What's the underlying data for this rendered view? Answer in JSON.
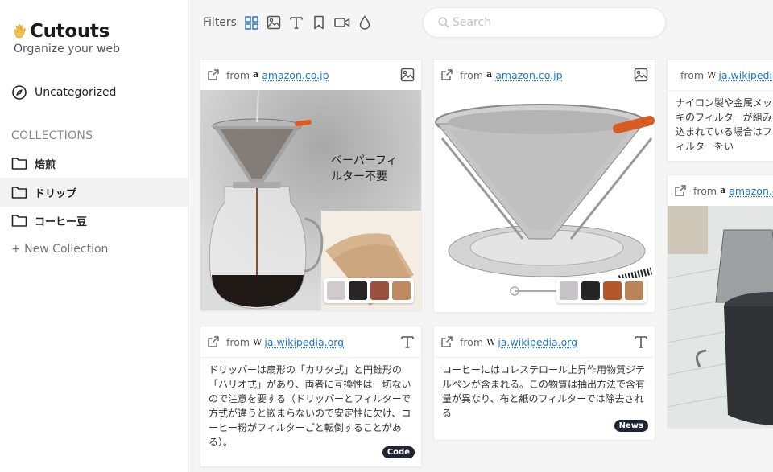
{
  "app": {
    "name": "Cutouts",
    "tagline": "Organize your web"
  },
  "sidebar": {
    "uncategorized": "Uncategorized",
    "collections_label": "COLLECTIONS",
    "collections": [
      "焙煎",
      "ドリップ",
      "コーヒー豆"
    ],
    "new_collection": "+ New Collection"
  },
  "toolbar": {
    "filters_label": "Filters",
    "filters": [
      "all-grid-icon",
      "image-icon",
      "text-icon",
      "bookmark-icon",
      "video-icon",
      "color-drop-icon"
    ],
    "search_placeholder": "Search",
    "accent": "#3b7bd8"
  },
  "cards": [
    {
      "from": "from",
      "source": "amazon.co.jp",
      "type": "image",
      "image_text": "ペーパーフィルター不要",
      "palette": [
        "#cfcbcc",
        "#282526",
        "#9b4f3d",
        "#c08a60"
      ]
    },
    {
      "from": "from",
      "source": "ja.wikipedia.org",
      "type": "text",
      "text": "ドリッパーは扇形の「カリタ式」と円錐形の「ハリオ式」があり、両者に互換性は一切ないので注意を要する（ドリッパーとフィルターで方式が違うと嵌まらないので安定性に欠け、コーヒー粉がフィルターごと転倒することがある）。",
      "tag": "Code"
    },
    {
      "from": "from",
      "source": "amazon.co.jp",
      "type": "image",
      "palette": [
        "#c7c4c8",
        "#262526",
        "#b4572a",
        "#b98458"
      ]
    },
    {
      "from": "from",
      "source": "ja.wikipedia.org",
      "type": "text",
      "text": "コーヒーにはコレステロール上昇作用物質ジテルペンが含まれる。この物質は抽出方法で含有量が異なり、布と紙のフィルターでは除去される",
      "tag": "News"
    },
    {
      "from": "from",
      "source": "ja.wikipedia.org",
      "type": "text",
      "text": "ナイロン製や金属メッキのフィルターが組み込まれている場合はフィルターをい"
    },
    {
      "from": "from",
      "source": "amazon.com",
      "type": "image"
    }
  ]
}
